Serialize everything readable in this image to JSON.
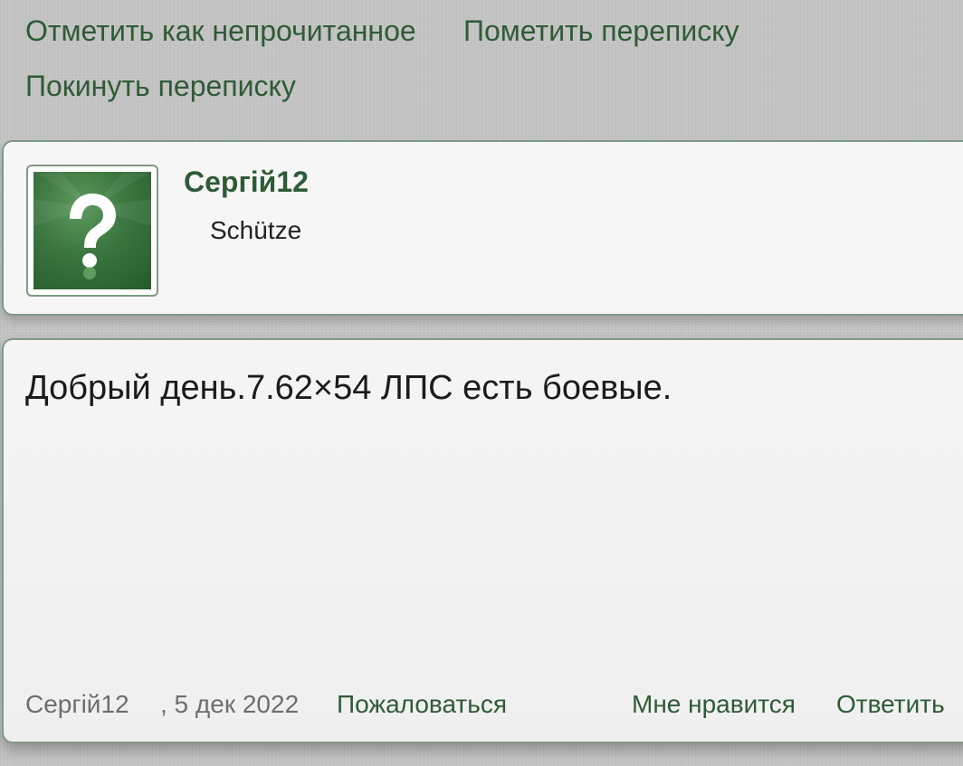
{
  "actions": {
    "mark_unread": "Отметить как непрочитанное",
    "mark_conversation": "Пометить переписку",
    "leave_conversation": "Покинуть переписку"
  },
  "user": {
    "name": "Сергій12",
    "title": "Schütze",
    "avatar_icon": "question-mark-icon"
  },
  "message": {
    "text": "Добрый день.7.62×54 ЛПС есть боевые.",
    "author": "Сергій12",
    "date": ", 5 дек 2022",
    "report_label": "Пожаловаться",
    "like_label": "Мне нравится",
    "reply_label": "Ответить"
  },
  "colors": {
    "accent": "#2e5b36",
    "border": "#7f9a83",
    "background": "#c3c3c3"
  }
}
